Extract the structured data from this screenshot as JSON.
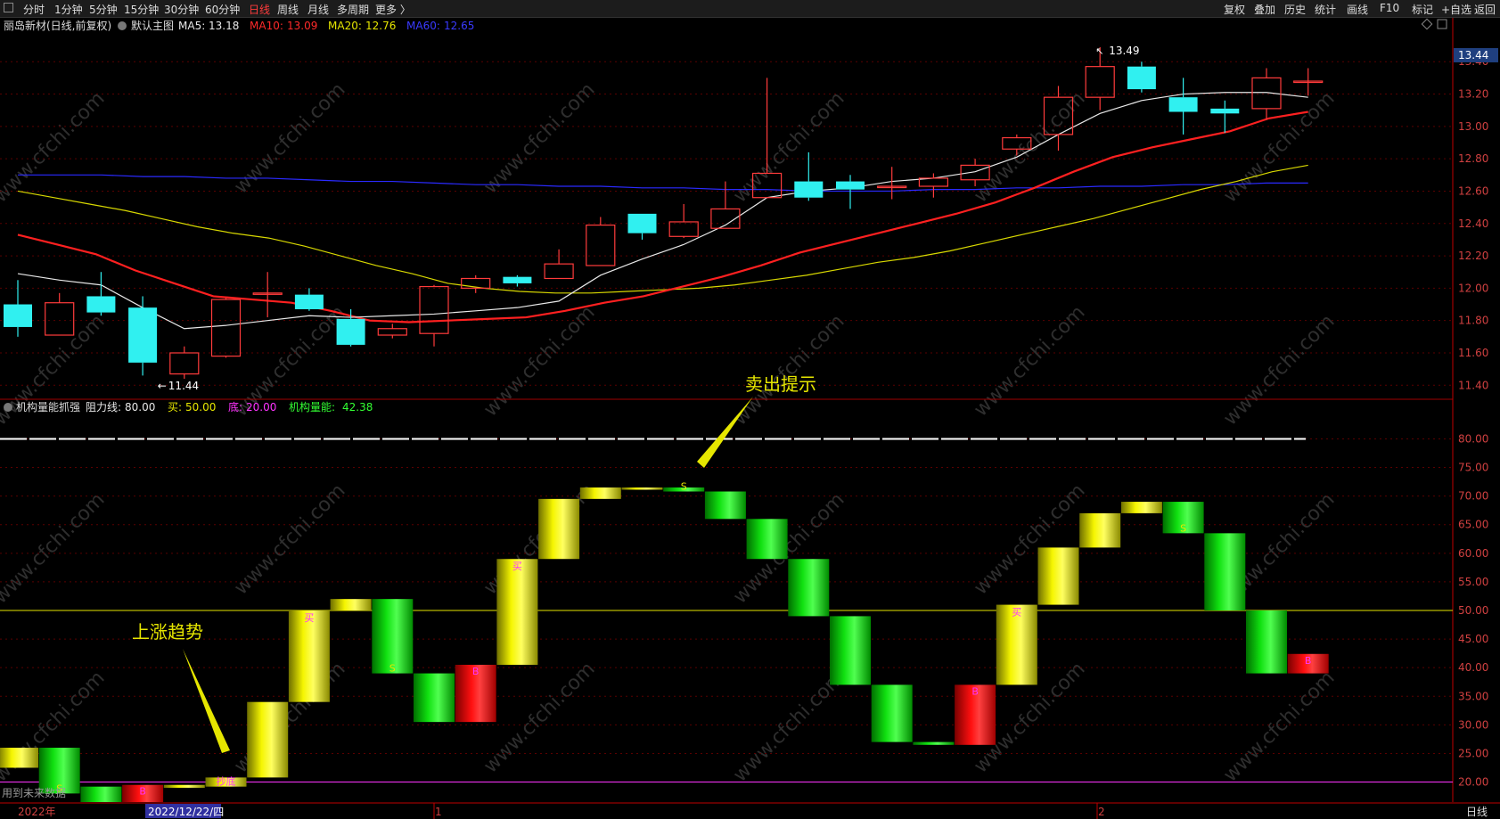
{
  "toolbar": {
    "left": [
      {
        "label": "分时",
        "active": false
      },
      {
        "label": "1分钟",
        "active": false
      },
      {
        "label": "5分钟",
        "active": false
      },
      {
        "label": "15分钟",
        "active": false
      },
      {
        "label": "30分钟",
        "active": false
      },
      {
        "label": "60分钟",
        "active": false
      },
      {
        "label": "日线",
        "active": true
      },
      {
        "label": "周线",
        "active": false
      },
      {
        "label": "月线",
        "active": false
      },
      {
        "label": "多周期",
        "active": false
      },
      {
        "label": "更多 〉",
        "active": false
      }
    ],
    "right": [
      "复权",
      "叠加",
      "历史",
      "统计",
      "画线",
      "F10",
      "标记",
      "+自选",
      "返回"
    ]
  },
  "main_pane": {
    "stock": "丽岛新材(日线,前复权)",
    "template": "默认主图",
    "ma": [
      {
        "label": "MA5:",
        "value": "13.18",
        "color": "#e8e8e8"
      },
      {
        "label": "MA10:",
        "value": "13.09",
        "color": "#ff2a2a"
      },
      {
        "label": "MA20:",
        "value": "12.76",
        "color": "#e6e600"
      },
      {
        "label": "MA60:",
        "value": "12.65",
        "color": "#3a3aff"
      }
    ],
    "price_ticks": [
      "13.40",
      "13.20",
      "13.00",
      "12.80",
      "12.60",
      "12.40",
      "12.20",
      "12.00",
      "11.80",
      "11.60",
      "11.40"
    ],
    "current_price": "13.44",
    "high_label": "13.49",
    "low_label": "11.44",
    "chart_data": {
      "type": "candlestick",
      "ylim": [
        11.33,
        13.55
      ],
      "candles": [
        {
          "o": 11.9,
          "c": 11.76,
          "h": 12.05,
          "l": 11.7
        },
        {
          "o": 11.71,
          "c": 11.91,
          "h": 11.97,
          "l": 11.71
        },
        {
          "o": 11.95,
          "c": 11.85,
          "h": 12.1,
          "l": 11.83
        },
        {
          "o": 11.88,
          "c": 11.54,
          "h": 11.95,
          "l": 11.46
        },
        {
          "o": 11.47,
          "c": 11.6,
          "h": 11.64,
          "l": 11.44
        },
        {
          "o": 11.58,
          "c": 11.93,
          "h": 11.94,
          "l": 11.57
        },
        {
          "o": 11.97,
          "c": 11.97,
          "h": 12.1,
          "l": 11.82
        },
        {
          "o": 11.96,
          "c": 11.87,
          "h": 12.0,
          "l": 11.86
        },
        {
          "o": 11.81,
          "c": 11.65,
          "h": 11.87,
          "l": 11.64
        },
        {
          "o": 11.71,
          "c": 11.75,
          "h": 11.78,
          "l": 11.69
        },
        {
          "o": 11.72,
          "c": 12.01,
          "h": 12.02,
          "l": 11.64
        },
        {
          "o": 12.0,
          "c": 12.06,
          "h": 12.08,
          "l": 11.97
        },
        {
          "o": 12.07,
          "c": 12.03,
          "h": 12.08,
          "l": 12.01
        },
        {
          "o": 12.06,
          "c": 12.15,
          "h": 12.24,
          "l": 12.06
        },
        {
          "o": 12.14,
          "c": 12.39,
          "h": 12.44,
          "l": 12.14
        },
        {
          "o": 12.46,
          "c": 12.34,
          "h": 12.46,
          "l": 12.3
        },
        {
          "o": 12.32,
          "c": 12.41,
          "h": 12.52,
          "l": 12.31
        },
        {
          "o": 12.37,
          "c": 12.49,
          "h": 12.66,
          "l": 12.37
        },
        {
          "o": 12.56,
          "c": 12.71,
          "h": 13.3,
          "l": 12.56
        },
        {
          "o": 12.66,
          "c": 12.56,
          "h": 12.84,
          "l": 12.54
        },
        {
          "o": 12.66,
          "c": 12.61,
          "h": 12.7,
          "l": 12.49
        },
        {
          "o": 12.63,
          "c": 12.63,
          "h": 12.75,
          "l": 12.55
        },
        {
          "o": 12.63,
          "c": 12.68,
          "h": 12.71,
          "l": 12.56
        },
        {
          "o": 12.67,
          "c": 12.76,
          "h": 12.8,
          "l": 12.63
        },
        {
          "o": 12.86,
          "c": 12.93,
          "h": 12.95,
          "l": 12.82
        },
        {
          "o": 12.95,
          "c": 13.18,
          "h": 13.25,
          "l": 12.85
        },
        {
          "o": 13.18,
          "c": 13.37,
          "h": 13.49,
          "l": 13.1
        },
        {
          "o": 13.37,
          "c": 13.23,
          "h": 13.4,
          "l": 13.21
        },
        {
          "o": 13.18,
          "c": 13.09,
          "h": 13.3,
          "l": 12.95
        },
        {
          "o": 13.11,
          "c": 13.08,
          "h": 13.16,
          "l": 12.96
        },
        {
          "o": 13.11,
          "c": 13.3,
          "h": 13.36,
          "l": 13.04
        },
        {
          "o": 13.28,
          "c": 13.28,
          "h": 13.36,
          "l": 13.19
        }
      ],
      "ma5": [
        12.09,
        12.05,
        12.02,
        11.88,
        11.75,
        11.77,
        11.8,
        11.83,
        11.82,
        11.83,
        11.84,
        11.86,
        11.88,
        11.92,
        12.08,
        12.18,
        12.27,
        12.39,
        12.56,
        12.6,
        12.62,
        12.66,
        12.68,
        12.72,
        12.81,
        12.95,
        13.08,
        13.16,
        13.2,
        13.21,
        13.21,
        13.18
      ],
      "ma10": [
        12.33,
        12.27,
        12.21,
        12.11,
        12.03,
        11.95,
        11.93,
        11.91,
        11.86,
        11.8,
        11.79,
        11.8,
        11.81,
        11.82,
        11.86,
        11.91,
        11.95,
        12.01,
        12.07,
        12.14,
        12.22,
        12.28,
        12.34,
        12.4,
        12.46,
        12.53,
        12.62,
        12.72,
        12.81,
        12.87,
        12.92,
        12.97,
        13.05,
        13.09
      ],
      "ma20": [
        12.6,
        12.56,
        12.52,
        12.48,
        12.43,
        12.38,
        12.34,
        12.31,
        12.26,
        12.2,
        12.14,
        12.09,
        12.03,
        12.0,
        11.98,
        11.97,
        11.97,
        11.98,
        11.99,
        12.0,
        12.02,
        12.05,
        12.08,
        12.12,
        12.16,
        12.19,
        12.23,
        12.28,
        12.33,
        12.38,
        12.43,
        12.49,
        12.55,
        12.61,
        12.66,
        12.72,
        12.76
      ],
      "ma60": [
        12.7,
        12.7,
        12.7,
        12.69,
        12.69,
        12.68,
        12.68,
        12.67,
        12.66,
        12.66,
        12.65,
        12.64,
        12.64,
        12.63,
        12.63,
        12.62,
        12.62,
        12.61,
        12.61,
        12.6,
        12.6,
        12.6,
        12.61,
        12.61,
        12.62,
        12.62,
        12.63,
        12.63,
        12.64,
        12.64,
        12.65,
        12.65
      ]
    }
  },
  "sub_pane": {
    "title": "机构量能抓强",
    "params": [
      {
        "label": "阻力线:",
        "value": "80.00",
        "color": "#e8e8e8"
      },
      {
        "label": "买:",
        "value": "50.00",
        "color": "#e6e600"
      },
      {
        "label": "底:",
        "value": "20.00",
        "color": "#ff33ff"
      },
      {
        "label": "机构量能:",
        "value": "42.38",
        "color": "#33ff33"
      }
    ],
    "ticks": [
      "80.00",
      "75.00",
      "70.00",
      "65.00",
      "60.00",
      "55.00",
      "50.00",
      "45.00",
      "40.00",
      "35.00",
      "30.00",
      "25.00",
      "20.00"
    ],
    "chart_data": {
      "type": "step-blocks",
      "ylim": [
        16.5,
        83.5
      ],
      "resistance": 80,
      "buy_line": 50,
      "bottom_line": 20,
      "blocks": [
        {
          "lo": 22.5,
          "hi": 26.0,
          "color": "yellow"
        },
        {
          "lo": 18.0,
          "hi": 26.0,
          "color": "green",
          "label": "S"
        },
        {
          "lo": 16.5,
          "hi": 19.2,
          "color": "green"
        },
        {
          "lo": 16.5,
          "hi": 19.5,
          "color": "red",
          "label": "B"
        },
        {
          "lo": 19.0,
          "hi": 19.5,
          "color": "yellow"
        },
        {
          "lo": 19.2,
          "hi": 20.8,
          "color": "yellow",
          "label": "抄底"
        },
        {
          "lo": 20.8,
          "hi": 34.0,
          "color": "yellow"
        },
        {
          "lo": 34.0,
          "hi": 50.0,
          "color": "yellow",
          "label": "买"
        },
        {
          "lo": 50.0,
          "hi": 52.0,
          "color": "yellow"
        },
        {
          "lo": 39.0,
          "hi": 52.0,
          "color": "green",
          "label": "S"
        },
        {
          "lo": 30.5,
          "hi": 39.0,
          "color": "green"
        },
        {
          "lo": 30.5,
          "hi": 40.5,
          "color": "red",
          "label": "B"
        },
        {
          "lo": 40.5,
          "hi": 59.0,
          "color": "yellow",
          "label": "买"
        },
        {
          "lo": 59.0,
          "hi": 69.5,
          "color": "yellow"
        },
        {
          "lo": 69.5,
          "hi": 71.5,
          "color": "yellow"
        },
        {
          "lo": 71.2,
          "hi": 71.5,
          "color": "yellow"
        },
        {
          "lo": 70.8,
          "hi": 71.5,
          "color": "green",
          "label": "S"
        },
        {
          "lo": 66.0,
          "hi": 70.8,
          "color": "green"
        },
        {
          "lo": 59.0,
          "hi": 66.0,
          "color": "green"
        },
        {
          "lo": 49.0,
          "hi": 59.0,
          "color": "green"
        },
        {
          "lo": 37.0,
          "hi": 49.0,
          "color": "green"
        },
        {
          "lo": 27.0,
          "hi": 37.0,
          "color": "green"
        },
        {
          "lo": 26.5,
          "hi": 27.0,
          "color": "green"
        },
        {
          "lo": 26.5,
          "hi": 37.0,
          "color": "red",
          "label": "B"
        },
        {
          "lo": 37.0,
          "hi": 51.0,
          "color": "yellow",
          "label": "买"
        },
        {
          "lo": 51.0,
          "hi": 61.0,
          "color": "yellow"
        },
        {
          "lo": 61.0,
          "hi": 67.0,
          "color": "yellow"
        },
        {
          "lo": 67.0,
          "hi": 69.0,
          "color": "yellow"
        },
        {
          "lo": 63.5,
          "hi": 69.0,
          "color": "green",
          "label": "S"
        },
        {
          "lo": 50.0,
          "hi": 63.5,
          "color": "green"
        },
        {
          "lo": 39.0,
          "hi": 50.0,
          "color": "green"
        },
        {
          "lo": 39.0,
          "hi": 42.4,
          "color": "red",
          "label": "B"
        }
      ]
    }
  },
  "annotations": {
    "sell_hint": "卖出提示",
    "uptrend": "上涨趋势"
  },
  "footer": {
    "future_data": "用到未来数据",
    "year": "2022年",
    "date": "2022/12/22/四",
    "month1": "1",
    "month2": "2",
    "period": "日线"
  },
  "watermark": "www.cfchi.com",
  "colors": {
    "up": "#ff3b3b",
    "down": "#30f0f0",
    "grid": "#7a0000",
    "axis": "#c00000"
  }
}
